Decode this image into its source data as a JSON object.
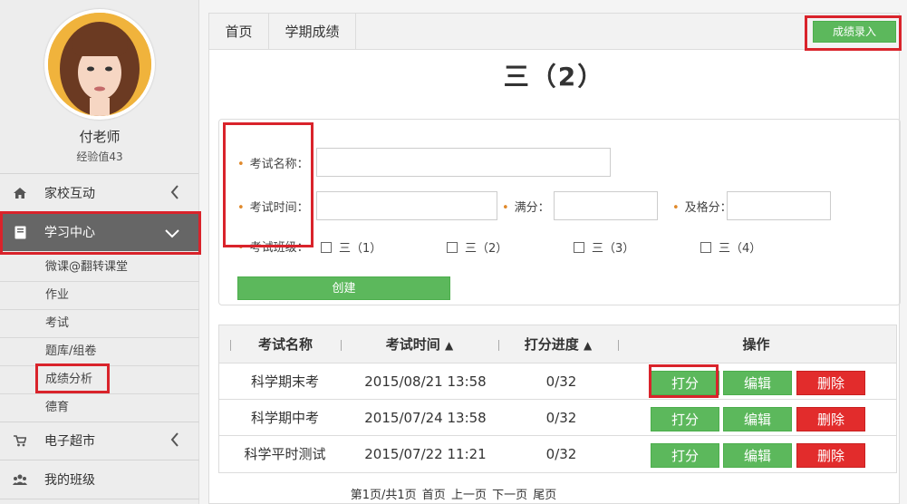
{
  "profile": {
    "name": "付老师",
    "exp": "经验值43"
  },
  "nav": {
    "items": [
      {
        "label": "家校互动",
        "icon": "home-icon"
      },
      {
        "label": "学习中心",
        "icon": "book-icon"
      },
      {
        "label": "电子超市",
        "icon": "cart-icon"
      },
      {
        "label": "我的班级",
        "icon": "group-icon"
      }
    ],
    "sub_items": [
      "微课@翻转课堂",
      "作业",
      "考试",
      "题库/组卷",
      "成绩分析",
      "德育"
    ]
  },
  "breadcrumb": {
    "home": "首页",
    "current": "学期成绩"
  },
  "action_button": "成绩录入",
  "page_title": "三（2）",
  "form": {
    "exam_name_label": "考试名称：",
    "exam_time_label": "考试时间：",
    "full_score_label": "满分：",
    "pass_score_label": "及格分：",
    "exam_class_label": "考试班级：",
    "classes": [
      "三（1）",
      "三（2）",
      "三（3）",
      "三（4）"
    ],
    "create_button": "创建"
  },
  "table": {
    "headers": {
      "name": "考试名称",
      "time": "考试时间",
      "progress": "打分进度",
      "actions": "操作"
    },
    "rows": [
      {
        "name": "科学期末考",
        "time": "2015/08/21 13:58",
        "progress": "0/32"
      },
      {
        "name": "科学期中考",
        "time": "2015/07/24 13:58",
        "progress": "0/32"
      },
      {
        "name": "科学平时测试",
        "time": "2015/07/22 11:21",
        "progress": "0/32"
      }
    ],
    "action_labels": {
      "grade": "打分",
      "edit": "编辑",
      "delete": "删除"
    }
  },
  "pagination": {
    "info": "第1页/共1页",
    "first": "首页",
    "prev": "上一页",
    "next": "下一页",
    "last": "尾页"
  },
  "colors": {
    "green": "#5cb85c",
    "red": "#e22c2c",
    "highlight": "#d9232b"
  }
}
